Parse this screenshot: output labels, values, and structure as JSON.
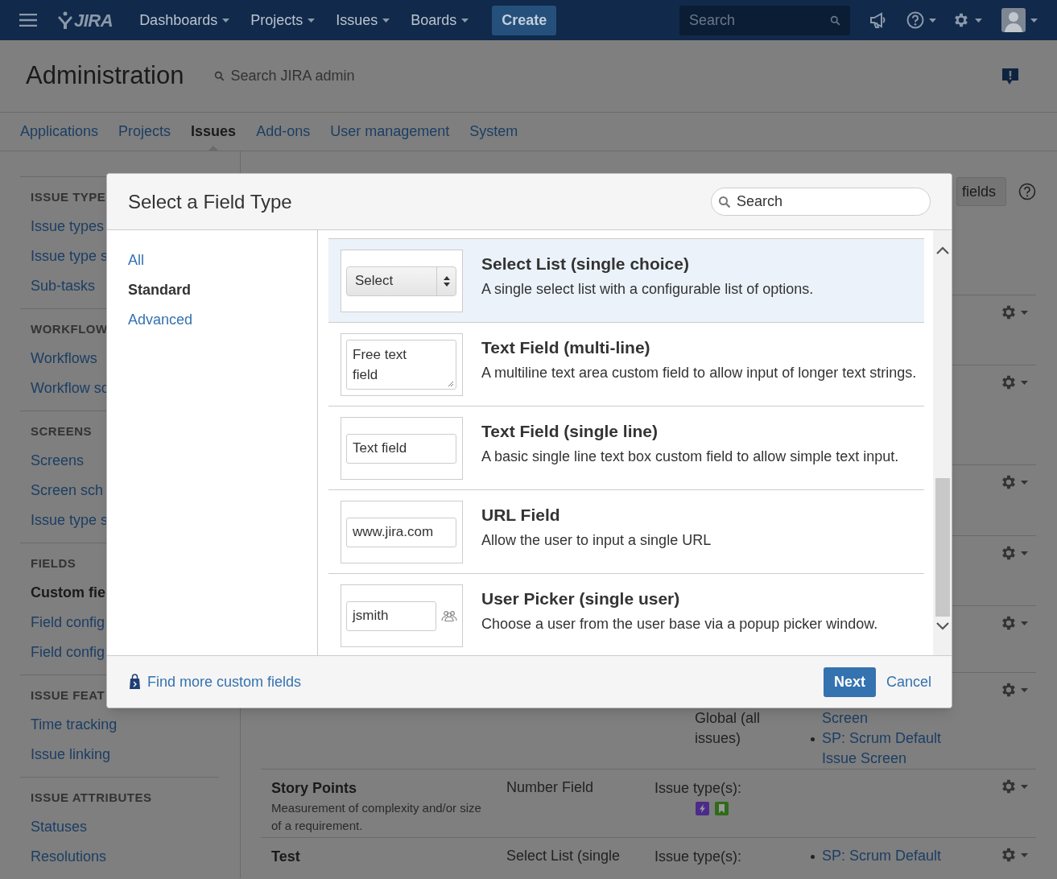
{
  "top_bar": {
    "logo": "JIRA",
    "menus": [
      {
        "label": "Dashboards"
      },
      {
        "label": "Projects"
      },
      {
        "label": "Issues"
      },
      {
        "label": "Boards"
      }
    ],
    "create": "Create",
    "search": {
      "placeholder": "Search"
    }
  },
  "admin_header": {
    "title": "Administration",
    "search": {
      "placeholder": "Search JIRA admin"
    }
  },
  "admin_tabs": [
    {
      "label": "Applications",
      "selected": false
    },
    {
      "label": "Projects",
      "selected": false
    },
    {
      "label": "Issues",
      "selected": true
    },
    {
      "label": "Add-ons",
      "selected": false
    },
    {
      "label": "User management",
      "selected": false
    },
    {
      "label": "System",
      "selected": false
    }
  ],
  "sidebar": [
    {
      "heading": "ISSUE TYPE",
      "items": [
        {
          "label": "Issue types",
          "selected": false
        },
        {
          "label": "Issue type s",
          "selected": false
        },
        {
          "label": "Sub-tasks",
          "selected": false
        }
      ]
    },
    {
      "heading": "WORKFLOW",
      "items": [
        {
          "label": "Workflows",
          "selected": false
        },
        {
          "label": "Workflow sc",
          "selected": false
        }
      ]
    },
    {
      "heading": "SCREENS",
      "items": [
        {
          "label": "Screens",
          "selected": false
        },
        {
          "label": "Screen sch",
          "selected": false
        },
        {
          "label": "Issue type s",
          "selected": false
        }
      ]
    },
    {
      "heading": "FIELDS",
      "items": [
        {
          "label": "Custom fie",
          "selected": true
        },
        {
          "label": "Field config",
          "selected": false
        },
        {
          "label": "Field config",
          "selected": false
        }
      ]
    },
    {
      "heading": "ISSUE FEAT",
      "items": [
        {
          "label": "Time tracking",
          "selected": false
        },
        {
          "label": "Issue linking",
          "selected": false
        }
      ]
    },
    {
      "heading": "ISSUE ATTRIBUTES",
      "items": [
        {
          "label": "Statuses",
          "selected": false
        },
        {
          "label": "Resolutions",
          "selected": false
        }
      ]
    }
  ],
  "content": {
    "add_button": "fields",
    "rows": [
      {},
      {},
      {},
      {},
      {},
      {
        "context": [
          "Global (all",
          "issues)"
        ],
        "screens": [
          {
            "label": "Screen",
            "bullet": false
          },
          {
            "label": "SP: Scrum Default Issue Screen",
            "bullet": true
          }
        ]
      },
      {
        "name": "Story Points",
        "description": "Measurement of complexity and/or size of a requirement.",
        "type": "Number Field",
        "issue_types_label": "Issue type(s):",
        "issue_type_icons": [
          {
            "color": "#4b2a8c"
          },
          {
            "color": "#2f6b1a"
          }
        ]
      },
      {
        "name": "Test",
        "type": "Select List (single",
        "issue_types_label": "Issue type(s):",
        "screens": [
          {
            "label": "SP: Scrum Default",
            "bullet": true
          }
        ]
      }
    ]
  },
  "dialog": {
    "title": "Select a Field Type",
    "search": {
      "placeholder": "Search"
    },
    "categories": [
      {
        "label": "All",
        "selected": false
      },
      {
        "label": "Standard",
        "selected": true
      },
      {
        "label": "Advanced",
        "selected": false
      }
    ],
    "field_types": [
      {
        "kind": "select",
        "preview": "Select",
        "title": "Select List (single choice)",
        "description": "A single select list with a configurable list of options.",
        "selected": true
      },
      {
        "kind": "textarea",
        "preview": "Free text field",
        "title": "Text Field (multi-line)",
        "description": "A multiline text area custom field to allow input of longer text strings.",
        "selected": false
      },
      {
        "kind": "text",
        "preview": "Text field",
        "title": "Text Field (single line)",
        "description": "A basic single line text box custom field to allow simple text input.",
        "selected": false
      },
      {
        "kind": "text",
        "preview": "www.jira.com",
        "title": "URL Field",
        "description": "Allow the user to input a single URL",
        "selected": false
      },
      {
        "kind": "user",
        "preview": "jsmith",
        "title": "User Picker (single user)",
        "description": "Choose a user from the user base via a popup picker window.",
        "selected": false
      }
    ],
    "footer_link": "Find more custom fields",
    "next": "Next",
    "cancel": "Cancel"
  }
}
